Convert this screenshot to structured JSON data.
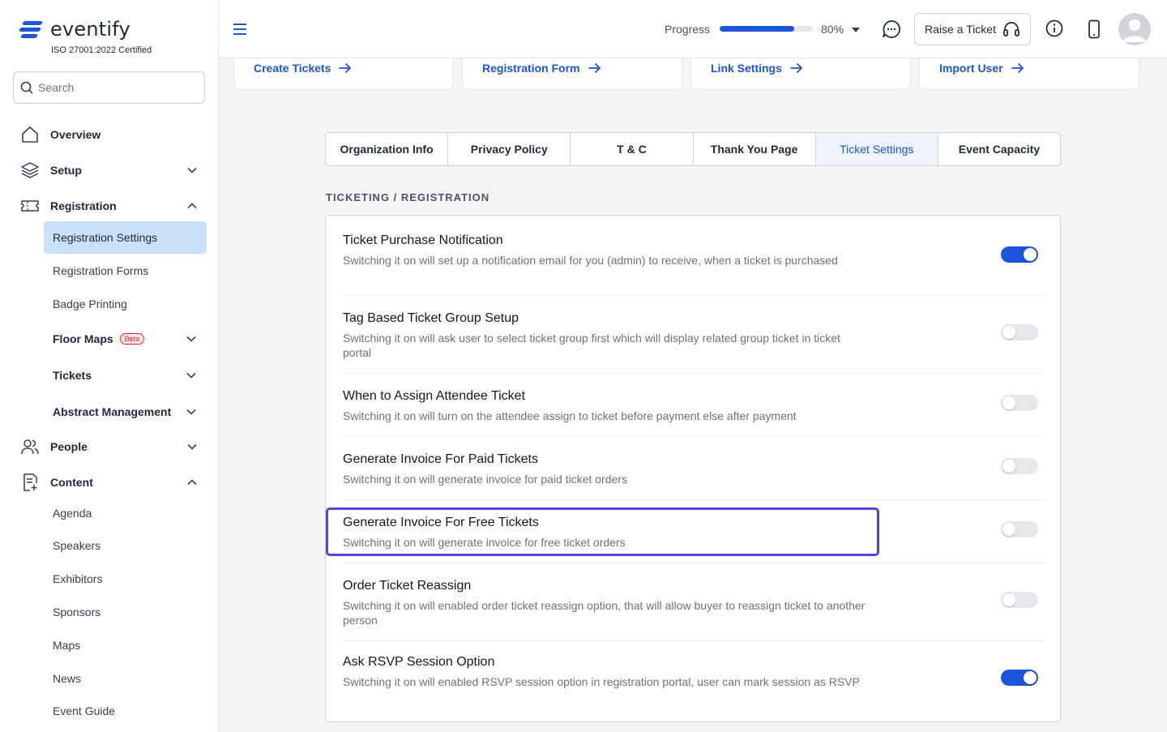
{
  "brand": {
    "name": "eventify",
    "certification": "ISO 27001:2022 Certified",
    "color": "#1a56db"
  },
  "search": {
    "placeholder": "Search"
  },
  "nav": {
    "overview": "Overview",
    "setup": "Setup",
    "registration": "Registration",
    "registration_sub": [
      "Registration Settings",
      "Registration Forms",
      "Badge Printing",
      "Floor Maps",
      "Tickets",
      "Abstract Management"
    ],
    "floor_maps_badge": "Beta",
    "people": "People",
    "content": "Content",
    "content_sub": [
      "Agenda",
      "Speakers",
      "Exhibitors",
      "Sponsors",
      "Maps",
      "News",
      "Event Guide"
    ]
  },
  "header": {
    "progress_label": "Progress",
    "progress_value": 80,
    "progress_text": "80%",
    "raise_ticket": "Raise a Ticket"
  },
  "quick_links": [
    "Create Tickets",
    "Registration Form",
    "Link Settings",
    "Import User"
  ],
  "tabs": [
    "Organization Info",
    "Privacy Policy",
    "T & C",
    "Thank You Page",
    "Ticket Settings",
    "Event Capacity"
  ],
  "active_tab": "Ticket Settings",
  "section_title": "TICKETING / REGISTRATION",
  "settings": [
    {
      "title": "Ticket Purchase Notification",
      "desc": "Switching it on will set up a notification email for you (admin) to receive, when a ticket is purchased",
      "enabled": true
    },
    {
      "title": "Tag Based Ticket Group Setup",
      "desc": "Switching it on will ask user to select ticket group first which will display related group ticket in ticket portal",
      "enabled": false
    },
    {
      "title": "When to Assign Attendee Ticket",
      "desc": "Switching it on will turn on the attendee assign to ticket before payment else after payment",
      "enabled": false
    },
    {
      "title": "Generate Invoice For Paid Tickets",
      "desc": "Switching it on will generate invoice for paid ticket orders",
      "enabled": false
    },
    {
      "title": "Generate Invoice For Free Tickets",
      "desc": "Switching it on will generate invoice for free ticket orders",
      "enabled": false
    },
    {
      "title": "Order Ticket Reassign",
      "desc": "Switching it on will enabled order ticket reassign option, that will allow buyer to reassign ticket to another person",
      "enabled": false
    },
    {
      "title": "Ask RSVP Session Option",
      "desc": "Switching it on will enabled RSVP session option in registration portal, user can mark session as RSVP",
      "enabled": true
    }
  ]
}
